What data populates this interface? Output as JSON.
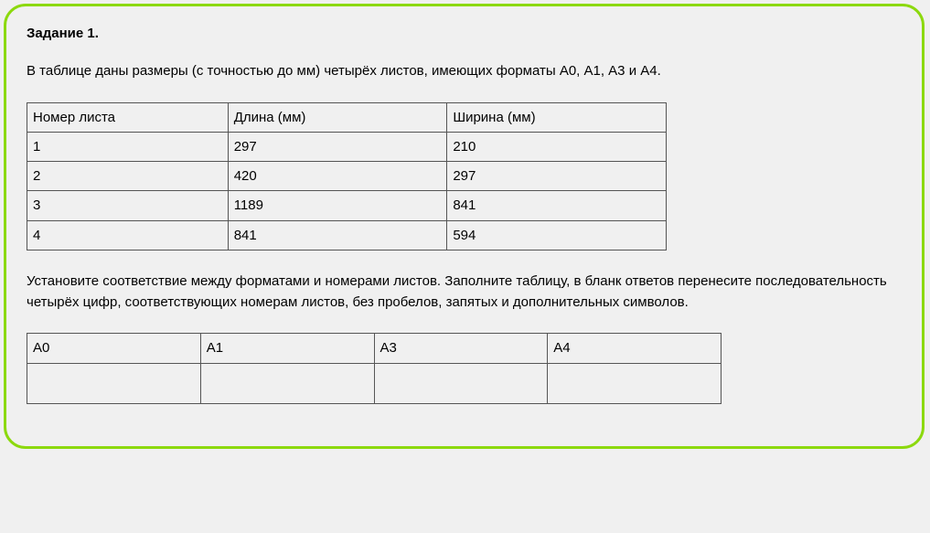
{
  "title": "Задание 1.",
  "intro": "В таблице даны размеры (с точностью до мм) четырёх листов, имеющих форматы А0, А1, А3 и А4.",
  "dataTable": {
    "headers": [
      "Номер листа",
      "Длина (мм)",
      "Ширина (мм)"
    ],
    "rows": [
      [
        "1",
        "297",
        "210"
      ],
      [
        "2",
        "420",
        "297"
      ],
      [
        "3",
        "1189",
        "841"
      ],
      [
        "4",
        "841",
        "594"
      ]
    ]
  },
  "instructions": "Установите соответствие между форматами и номерами листов. Заполните таблицу, в бланк ответов перенесите последовательность четырёх цифр, соответствующих номерам листов, без пробелов, запятых и дополнительных символов.",
  "answerTable": {
    "headers": [
      "А0",
      "А1",
      "А3",
      "А4"
    ],
    "cells": [
      "",
      "",
      "",
      ""
    ]
  }
}
